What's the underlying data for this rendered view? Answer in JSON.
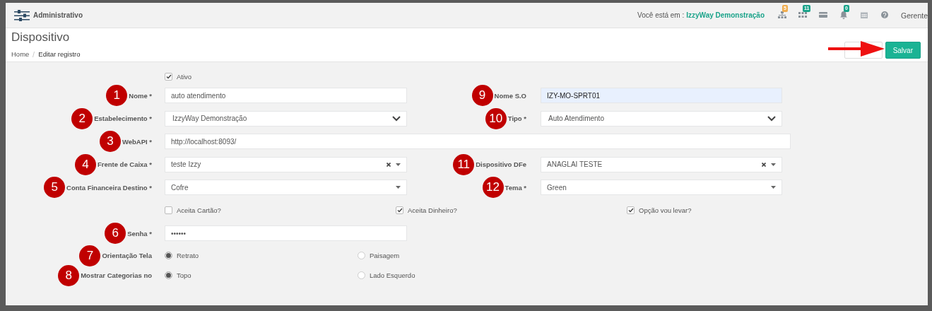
{
  "topbar": {
    "title": "Administrativo",
    "location_label": "Você está em :",
    "location": "IzzyWay Demonstração",
    "icons": [
      {
        "kind": "sitemap",
        "badge": "5",
        "color": "#f0ad4e"
      },
      {
        "kind": "grid",
        "badge": "11",
        "color": "#1aa38a"
      },
      {
        "kind": "card"
      },
      {
        "kind": "bell",
        "badge": "0",
        "color": "#1aa38a"
      },
      {
        "kind": "calendar"
      },
      {
        "kind": "help"
      }
    ],
    "user": "Gerente"
  },
  "header": {
    "title": "Dispositivo",
    "breadcrumb": [
      "Home",
      "Editar registro"
    ],
    "buttons": [
      {
        "kind": "default"
      },
      {
        "label": "Salvar",
        "kind": "primary"
      }
    ]
  },
  "ativo": {
    "label": "Ativo",
    "checked": true
  },
  "rows": [
    {
      "left": {
        "marker": "1",
        "label": "Nome *",
        "kind": "text",
        "value": "auto atendimento",
        "highlighted": false
      },
      "right": {
        "marker": "9",
        "label": "Nome S.O",
        "kind": "text",
        "value": "IZY-MO-SPRT01",
        "highlighted": true
      }
    },
    {
      "left": {
        "marker": "2",
        "label": "Estabelecimento *",
        "kind": "select",
        "value": "IzzyWay Demonstração"
      },
      "right": {
        "marker": "10",
        "label": "Tipo *",
        "kind": "select",
        "value": "Auto Atendimento"
      }
    },
    {
      "left": {
        "marker": "3",
        "label": "WebAPI *",
        "kind": "text",
        "value": "http://localhost:8093/",
        "highlighted": false
      }
    },
    {
      "left": {
        "marker": "4",
        "label": "Frente de Caixa *",
        "kind": "combo",
        "value": "teste Izzy",
        "clearable": true
      },
      "right": {
        "marker": "11",
        "label": "Dispositivo DFe",
        "kind": "combo",
        "value": "ANAGLAI TESTE",
        "clearable": true
      }
    },
    {
      "left": {
        "marker": "5",
        "label": "Conta Financeira Destino *",
        "kind": "combo",
        "value": "Cofre",
        "clearable": false
      },
      "right": {
        "marker": "12",
        "label": "Tema *",
        "kind": "combo",
        "value": "Green",
        "clearable": false
      }
    }
  ],
  "options": [
    {
      "label": "Aceita Cartão?",
      "checked": false
    },
    {
      "label": "Aceita Dinheiro?",
      "checked": true
    },
    {
      "label": "Opção vou levar?",
      "checked": true
    }
  ],
  "password": {
    "marker": "6",
    "label": "Senha *",
    "value": "••••••"
  },
  "radio_groups": [
    {
      "marker": "7",
      "label": "Orientação Tela",
      "options": [
        {
          "label": "Retrato",
          "selected": true
        },
        {
          "label": "Paisagem",
          "selected": false
        }
      ]
    },
    {
      "marker": "8",
      "label": "Mostrar Categorias no",
      "options": [
        {
          "label": "Topo",
          "selected": true
        },
        {
          "label": "Lado Esquerdo",
          "selected": false
        }
      ]
    }
  ]
}
